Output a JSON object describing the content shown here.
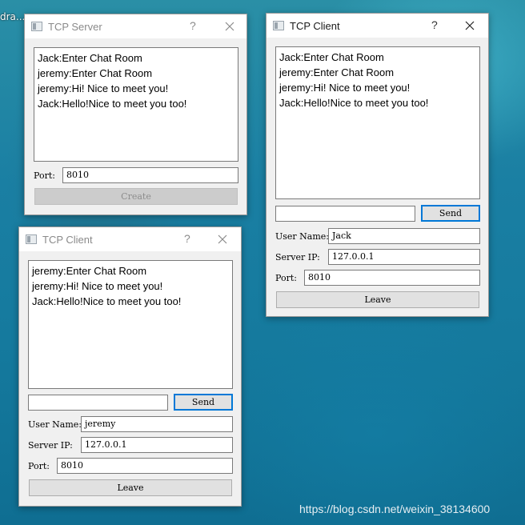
{
  "desktop": {
    "icon_label": "dra...",
    "watermark": "https://blog.csdn.net/weixin_38134600"
  },
  "server": {
    "title": "TCP Server",
    "help": "?",
    "messages": [
      "Jack:Enter Chat Room",
      "jeremy:Enter Chat Room",
      "jeremy:Hi! Nice to meet you!",
      "Jack:Hello!Nice to meet you too!"
    ],
    "port_label": "Port:",
    "port_value": "8010",
    "create_label": "Create"
  },
  "client_jack": {
    "title": "TCP Client",
    "help": "?",
    "messages": [
      "Jack:Enter Chat Room",
      "jeremy:Enter Chat Room",
      "jeremy:Hi! Nice to meet you!",
      "Jack:Hello!Nice to meet you too!"
    ],
    "message_input": "",
    "send_label": "Send",
    "username_label": "User Name:",
    "username_value": "Jack",
    "serverip_label": "Server IP:",
    "serverip_value": "127.0.0.1",
    "port_label": "Port:",
    "port_value": "8010",
    "leave_label": "Leave"
  },
  "client_jeremy": {
    "title": "TCP Client",
    "help": "?",
    "messages": [
      "jeremy:Enter Chat Room",
      "jeremy:Hi! Nice to meet you!",
      "Jack:Hello!Nice to meet you too!"
    ],
    "message_input": "",
    "send_label": "Send",
    "username_label": "User Name:",
    "username_value": "jeremy",
    "serverip_label": "Server IP:",
    "serverip_value": "127.0.0.1",
    "port_label": "Port:",
    "port_value": "8010",
    "leave_label": "Leave"
  }
}
